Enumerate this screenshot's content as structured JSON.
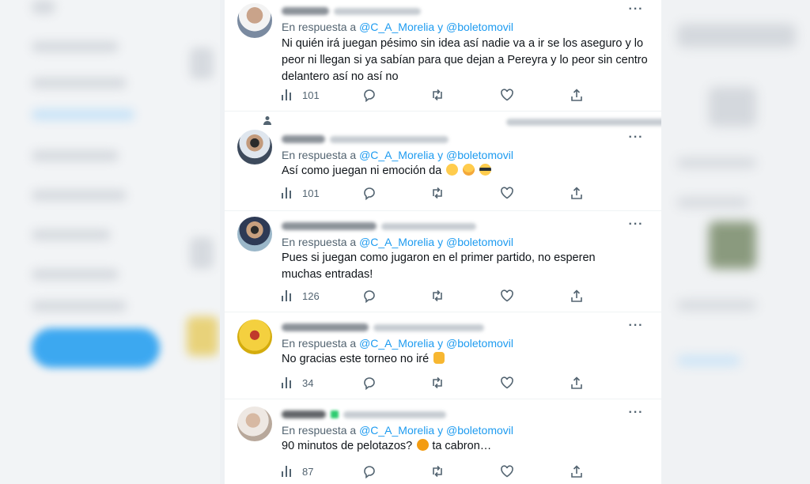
{
  "tweets": [
    {
      "reply_prefix": "En respuesta a",
      "mention": "@C_A_Morelia y @boletomovil",
      "text": "Ni quién irá juegan pésimo sin idea así nadie va a ir se los aseguro y lo peor ni llegan si ya sabían para que dejan a Pereyra y lo peor sin centro delantero así no así no",
      "views": "101"
    },
    {
      "reply_prefix": "En respuesta a",
      "mention": "@C_A_Morelia y @boletomovil",
      "text": "Así como juegan ni emoción da",
      "views": "101"
    },
    {
      "reply_prefix": "En respuesta a",
      "mention": "@C_A_Morelia y @boletomovil",
      "text": "Pues si juegan como jugaron en el primer partido, no esperen muchas entradas!",
      "views": "126"
    },
    {
      "reply_prefix": "En respuesta a",
      "mention": "@C_A_Morelia y @boletomovil",
      "text": "No gracias este torneo no iré",
      "views": "34"
    },
    {
      "reply_prefix": "En respuesta a",
      "mention": "@C_A_Morelia y @boletomovil",
      "text": "90 minutos de pelotazos?",
      "text_tail": "ta cabron…",
      "views": "87"
    }
  ],
  "icons": [
    "views-icon",
    "reply-icon",
    "retweet-icon",
    "like-icon",
    "share-icon",
    "more-icon"
  ],
  "colors": {
    "link": "#1d9bf0",
    "muted": "#536471",
    "text": "#0f1419"
  }
}
